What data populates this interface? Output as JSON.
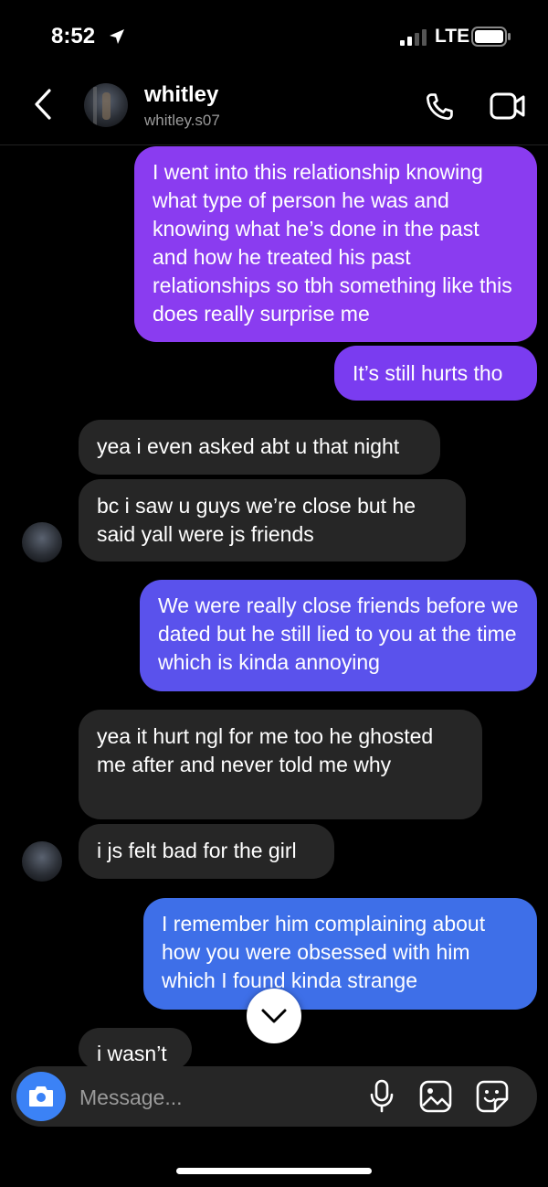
{
  "status": {
    "time": "8:52",
    "network": "LTE"
  },
  "header": {
    "name": "whitley",
    "handle": "whitley.s07"
  },
  "messages": [
    {
      "from": "me",
      "text": "I went into this relationship knowing what type of person he was and knowing what he’s done in the past and how he treated his past relationships so tbh something like this does really surprise me"
    },
    {
      "from": "me",
      "text": "It’s still hurts tho"
    },
    {
      "from": "them",
      "text": "yea i even asked abt u that night"
    },
    {
      "from": "them",
      "text": "bc i saw u guys we’re close but he said yall were js friends"
    },
    {
      "from": "me",
      "text": "We were really close friends before we dated but he still lied to you at the time which is kinda annoying"
    },
    {
      "from": "them",
      "text": "yea it hurt ngl for me too he ghosted me after and never told me why"
    },
    {
      "from": "them",
      "text": "i js felt bad for the girl"
    },
    {
      "from": "me",
      "text": "I remember him complaining about how you were obsessed with him which I found kinda strange"
    },
    {
      "from": "them",
      "text": "i wasn’t"
    }
  ],
  "composer": {
    "placeholder": "Message..."
  },
  "colors": {
    "bubble_top": "#8a3cf0",
    "bubble_mid": "#5a52ec",
    "bubble_bottom": "#3e6fe8",
    "incoming": "#262626",
    "camera": "#3b82f6"
  },
  "icons": [
    "location-arrow-icon",
    "signal-icon",
    "battery-icon",
    "back-chevron-icon",
    "phone-icon",
    "video-icon",
    "chevron-down-icon",
    "camera-icon",
    "microphone-icon",
    "gallery-icon",
    "sticker-icon"
  ]
}
